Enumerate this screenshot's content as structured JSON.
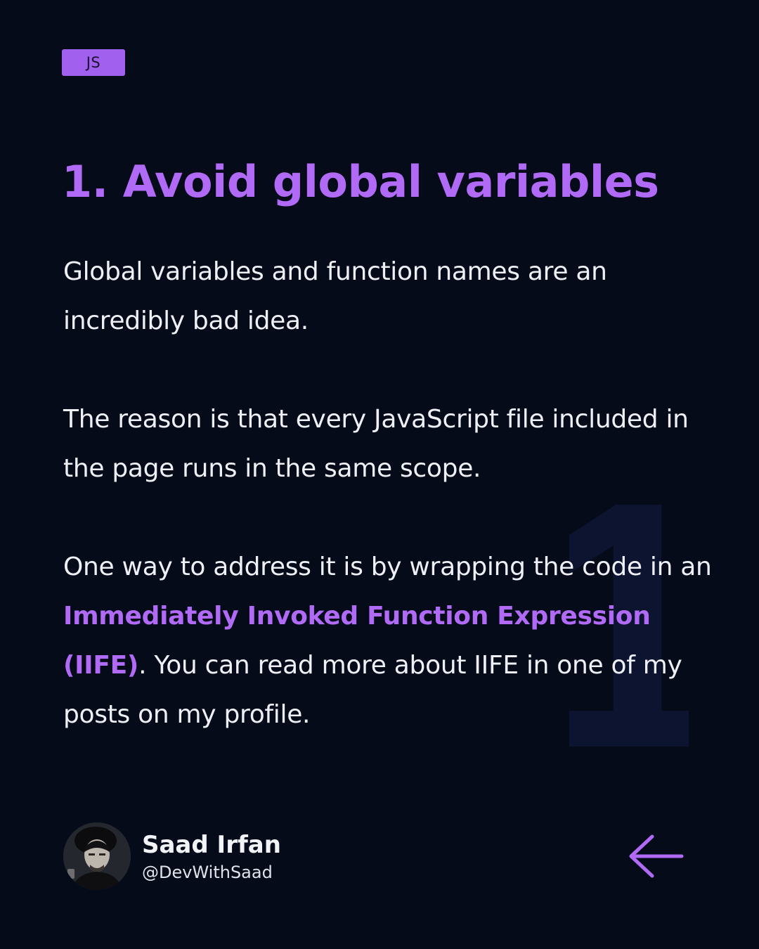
{
  "tag": {
    "label": "JS"
  },
  "title": "1. Avoid global variables",
  "paragraphs": {
    "p1": "Global variables and function names are an incredibly bad idea.",
    "p2": "The reason is that every JavaScript file included in the page runs in the same scope.",
    "p3": {
      "before": "One way to address it is by wrapping the code in an ",
      "highlight": "Immediately Invoked Function Expression (IIFE)",
      "after": ". You can read more about IIFE in one of my posts on my profile."
    }
  },
  "background_numeral": "1",
  "author": {
    "name": "Saad Irfan",
    "handle": "@DevWithSaad"
  },
  "navigation": {
    "icon": "arrow-left-icon"
  },
  "colors": {
    "background": "#060b1a",
    "accent": "#b06af5",
    "tag_background": "#a260ef",
    "text": "#eef0f6",
    "numeral": "#0d1430"
  }
}
